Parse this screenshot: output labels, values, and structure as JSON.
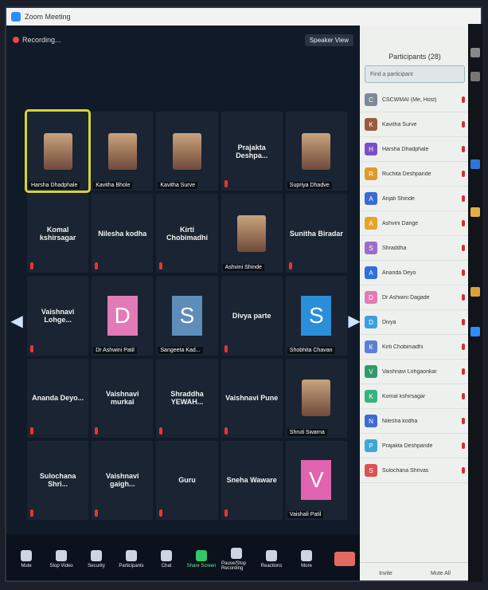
{
  "window": {
    "title": "Zoom Meeting"
  },
  "topbar": {
    "recording": "Recording...",
    "view": "Speaker View"
  },
  "tiles": [
    {
      "name": "Harsha Dhadphale",
      "kind": "photo",
      "active": true
    },
    {
      "name": "Kavitha Bhole",
      "kind": "photo"
    },
    {
      "name": "Kavitha Surve",
      "kind": "photo"
    },
    {
      "name": "Prajakta Deshpa...",
      "kind": "text"
    },
    {
      "name": "Supriya Dhadve",
      "kind": "photo"
    },
    {
      "name": "Komal kshirsagar",
      "kind": "text"
    },
    {
      "name": "Nilesha kodha",
      "kind": "text"
    },
    {
      "name": "Kirti Chobimadhi",
      "kind": "text"
    },
    {
      "name": "Ashvini Shinde",
      "kind": "photo"
    },
    {
      "name": "Sunitha Biradar",
      "kind": "text"
    },
    {
      "name": "Vaishnavi Lohge...",
      "kind": "text"
    },
    {
      "name": "Dr Ashwini Patil",
      "kind": "avatar",
      "letter": "D",
      "color": "#e27bb5"
    },
    {
      "name": "Sangeeta Kad...",
      "kind": "avatar",
      "letter": "S",
      "color": "#5d8db8"
    },
    {
      "name": "Divya parte",
      "kind": "text"
    },
    {
      "name": "Shobhita Chavan",
      "kind": "avatar",
      "letter": "S",
      "color": "#2a8fd8"
    },
    {
      "name": "Ananda Deyo...",
      "kind": "text"
    },
    {
      "name": "Vaishnavi murkal",
      "kind": "text"
    },
    {
      "name": "Shraddha YEWAH...",
      "kind": "text"
    },
    {
      "name": "Vaishnavi Pune",
      "kind": "text"
    },
    {
      "name": "Shruti Swarna",
      "kind": "photo"
    },
    {
      "name": "Sulochana Shri...",
      "kind": "text"
    },
    {
      "name": "Vaishnavi gaigh...",
      "kind": "text"
    },
    {
      "name": "Guru",
      "kind": "text"
    },
    {
      "name": "Sneha Waware",
      "kind": "text"
    },
    {
      "name": "Vaishali Patil",
      "kind": "avatar",
      "letter": "V",
      "color": "#e064b0"
    }
  ],
  "toolbar": {
    "items": [
      "Mute",
      "Stop Video",
      "Security",
      "Participants",
      "Chat",
      "Share Screen",
      "Pause/Stop Recording",
      "Reactions",
      "More"
    ]
  },
  "panel": {
    "title": "Participants (28)",
    "search_placeholder": "Find a participant",
    "participants": [
      {
        "name": "CSCWMAI (Me, Host)",
        "letter": "C",
        "color": "#7d8a99"
      },
      {
        "name": "Kavitha Surve",
        "letter": "K",
        "color": "#9b5a3c"
      },
      {
        "name": "Harsha Dhadphale",
        "letter": "H",
        "color": "#7a4fc7"
      },
      {
        "name": "Ruchita Deshpande",
        "letter": "R",
        "color": "#e09a2c"
      },
      {
        "name": "Anjali Shinde",
        "letter": "A",
        "color": "#3c6bd1"
      },
      {
        "name": "Ashvini Dange",
        "letter": "A",
        "color": "#e8a32a"
      },
      {
        "name": "Shraddha",
        "letter": "S",
        "color": "#9b6fc9"
      },
      {
        "name": "Ananda Deyo",
        "letter": "A",
        "color": "#2f6fdc"
      },
      {
        "name": "Dr Ashwini Dagade",
        "letter": "D",
        "color": "#e27bb5"
      },
      {
        "name": "Divya",
        "letter": "D",
        "color": "#3aa0e0"
      },
      {
        "name": "Kirti Chobimadhi",
        "letter": "K",
        "color": "#5c7fd6"
      },
      {
        "name": "Vaishnavi Lohgaonkar",
        "letter": "V",
        "color": "#2f9a6a"
      },
      {
        "name": "Komal kshirsagar",
        "letter": "K",
        "color": "#36b37e"
      },
      {
        "name": "Nilesha kodha",
        "letter": "N",
        "color": "#3c6bd1"
      },
      {
        "name": "Prajakta Deshpande",
        "letter": "P",
        "color": "#3fa7d6"
      },
      {
        "name": "Sulochana Shrivas",
        "letter": "S",
        "color": "#d9534f"
      }
    ],
    "invite": "Invite",
    "mute_all": "Mute All"
  }
}
